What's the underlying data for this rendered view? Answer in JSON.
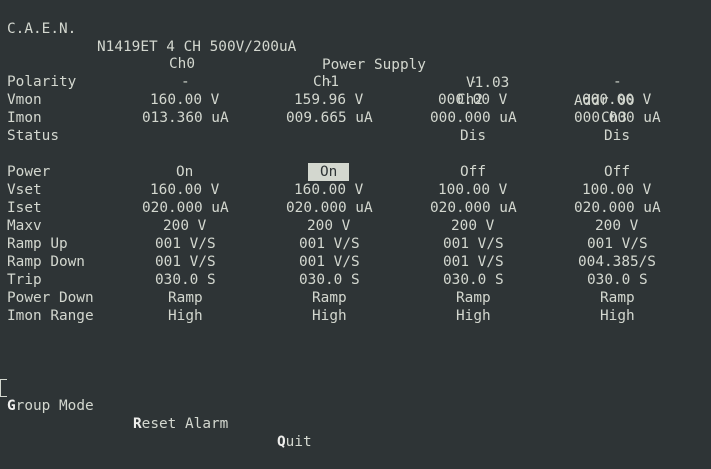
{
  "header": {
    "brand": "C.A.E.N.",
    "model": "N1419ET 4 CH 500V/200uA",
    "product": "Power Supply",
    "version": "V1.03",
    "address": "Addr 00"
  },
  "channels": [
    "Ch0",
    "Ch1",
    "Ch2",
    "Ch3"
  ],
  "monitor_rows": [
    {
      "label": "Polarity",
      "values": [
        "-",
        "-",
        "-",
        "-"
      ]
    },
    {
      "label": "Vmon",
      "values": [
        "160.00 V",
        "159.96 V",
        "000.00 V",
        "000.00 V"
      ]
    },
    {
      "label": "Imon",
      "values": [
        "013.360 uA",
        "009.665 uA",
        "000.000 uA",
        "000.000 uA"
      ]
    },
    {
      "label": "Status",
      "values": [
        "",
        "",
        "Dis",
        "Dis"
      ]
    }
  ],
  "setting_rows": [
    {
      "label": "Power",
      "values": [
        "On",
        "On",
        "Off",
        "Off"
      ]
    },
    {
      "label": "Vset",
      "values": [
        "160.00 V",
        "160.00 V",
        "100.00 V",
        "100.00 V"
      ]
    },
    {
      "label": "Iset",
      "values": [
        "020.000 uA",
        "020.000 uA",
        "020.000 uA",
        "020.000 uA"
      ]
    },
    {
      "label": "Maxv",
      "values": [
        "200 V",
        "200 V",
        "200 V",
        "200 V"
      ]
    },
    {
      "label": "Ramp Up",
      "values": [
        "001 V/S",
        "001 V/S",
        "001 V/S",
        "001 V/S"
      ]
    },
    {
      "label": "Ramp Down",
      "values": [
        "001 V/S",
        "001 V/S",
        "001 V/S",
        "004.385/S"
      ]
    },
    {
      "label": "Trip",
      "values": [
        "030.0 S",
        "030.0 S",
        "030.0 S",
        "030.0 S"
      ]
    },
    {
      "label": "Power Down",
      "values": [
        "Ramp",
        "Ramp",
        "Ramp",
        "Ramp"
      ]
    },
    {
      "label": "Imon Range",
      "values": [
        "High",
        "High",
        "High",
        "High"
      ]
    }
  ],
  "selected": {
    "row": "Power",
    "channel": "Ch1"
  },
  "menu": [
    {
      "hotkey": "G",
      "rest": "roup Mode"
    },
    {
      "hotkey": "R",
      "rest": "eset Alarm"
    },
    {
      "hotkey": "Q",
      "rest": "uit"
    }
  ],
  "colors": {
    "background": "#2e3436",
    "foreground": "#d3d7cf"
  }
}
